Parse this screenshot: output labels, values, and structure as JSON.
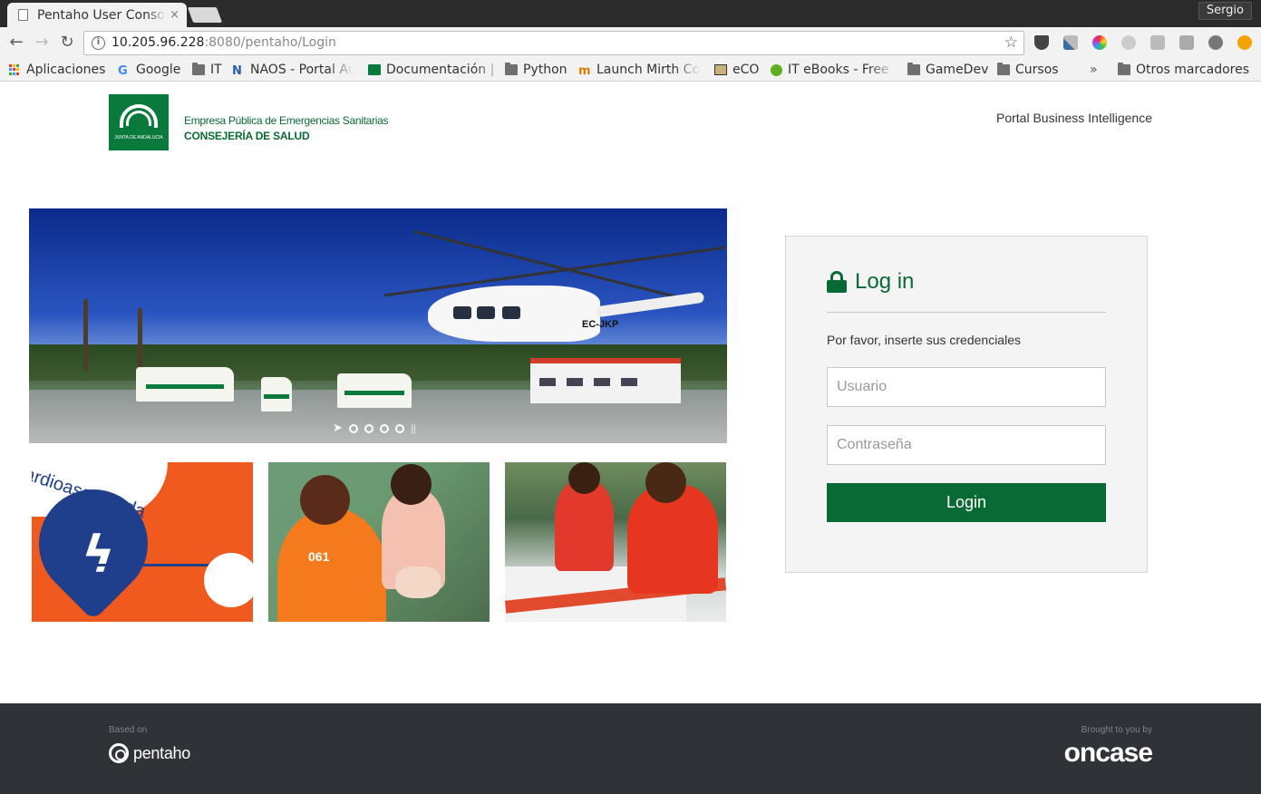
{
  "browser": {
    "tab_title": "Pentaho User Console",
    "tab_close": "×",
    "profile_name": "Sergio",
    "url_host": "10.205.96.228",
    "url_path": ":8080/pentaho/Login",
    "bookmarks": [
      {
        "label": "Aplicaciones",
        "icon": "apps-grid-icon"
      },
      {
        "label": "Google",
        "icon": "google-icon"
      },
      {
        "label": "IT",
        "icon": "folder-icon"
      },
      {
        "label": "NAOS - Portal Au",
        "icon": "naos-icon"
      },
      {
        "label": "Documentación |",
        "icon": "doc-icon"
      },
      {
        "label": "Python",
        "icon": "folder-icon"
      },
      {
        "label": "Launch Mirth Co",
        "icon": "mirth-icon"
      },
      {
        "label": "eCO",
        "icon": "eco-icon"
      },
      {
        "label": "IT eBooks - Free E",
        "icon": "ebooks-icon"
      },
      {
        "label": "GameDev",
        "icon": "folder-icon"
      },
      {
        "label": "Cursos",
        "icon": "folder-icon"
      }
    ],
    "bookmarks_overflow": "»",
    "other_bookmarks": "Otros marcadores"
  },
  "header": {
    "org_line1": "Empresa Pública de Emergencias Sanitarias",
    "org_line2": "CONSEJERÍA DE SALUD",
    "logo_text": "JUNTA DE ANDALUCIA",
    "portal_title": "Portal Business Intelligence"
  },
  "carousel": {
    "heli_registration": "EC-JKP",
    "slide_count": 4,
    "thumb1_caption": "ardioasegurada",
    "thumb2_label": "061"
  },
  "login": {
    "title": "Log in",
    "hint": "Por favor, inserte sus credenciales",
    "username_placeholder": "Usuario",
    "password_placeholder": "Contraseña",
    "button_label": "Login"
  },
  "footer": {
    "based_on": "Based on",
    "pentaho": "pentaho",
    "brought_by": "Brought to you by",
    "oncase": "oncase"
  },
  "colors": {
    "brand_green": "#0a6a35",
    "footer_bg": "#2f3338"
  }
}
